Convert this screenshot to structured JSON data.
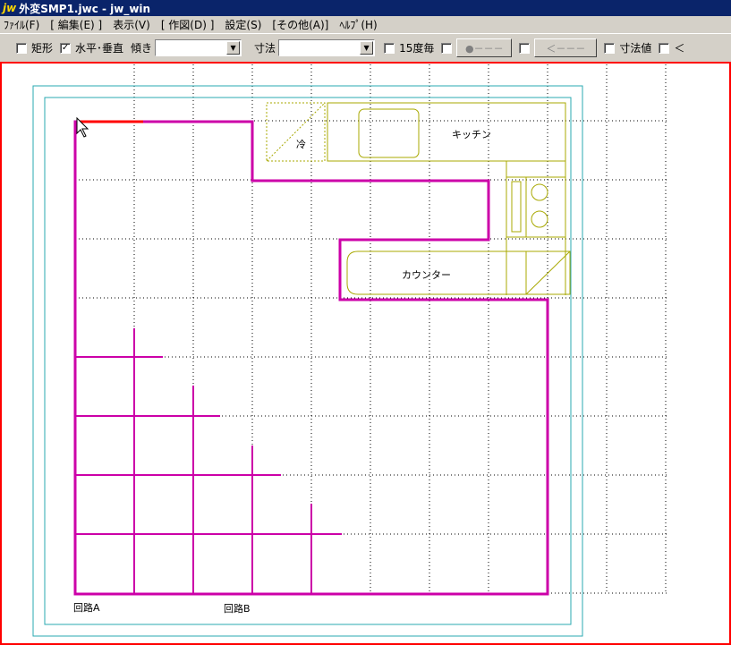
{
  "window": {
    "logo": "jw",
    "title": "外変SMP1.jwc - jw_win"
  },
  "menu": [
    "ﾌｧｲﾙ(F)",
    "[ 編集(E) ]",
    "表示(V)",
    "[ 作図(D) ]",
    "設定(S)",
    "[その他(A)]",
    "ﾍﾙﾌﾟ(H)"
  ],
  "toolbar": {
    "rect_label": "矩形",
    "rect_checked": false,
    "hv_label": "水平･垂直",
    "hv_checked": true,
    "slope_label": "傾き",
    "slope_value": "",
    "dim_label": "寸法",
    "dim_value": "",
    "deg15_label": "15度毎",
    "deg15_checked": false,
    "btn1_label": "●－－－",
    "btn2_label": "＜－－－",
    "dimval_label": "寸法値",
    "dimval_checked": false,
    "last_label": "＜"
  },
  "drawing": {
    "kitchen_label": "キッチン",
    "fridge_label": "冷",
    "counter_label": "カウンター",
    "circuit_a_label": "回路A",
    "circuit_b_label": "回路B",
    "colors": {
      "wall": "#cc00a8",
      "fixture": "#a8a800",
      "frame": "#2aa8b0",
      "grid": "#000000",
      "border": "#ff0000"
    }
  }
}
